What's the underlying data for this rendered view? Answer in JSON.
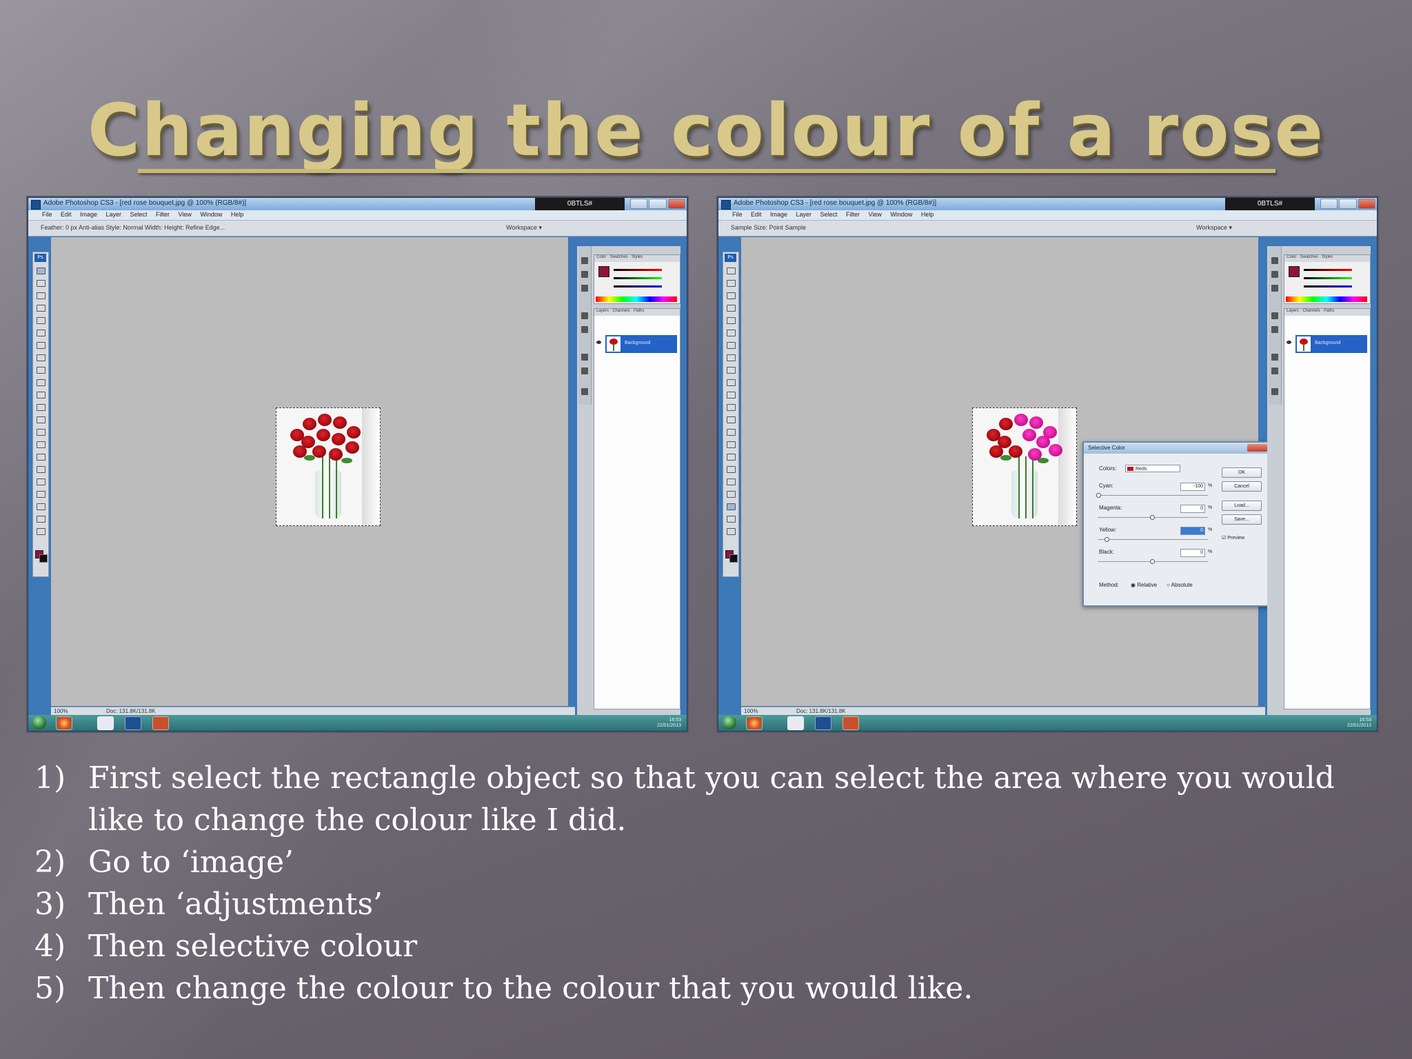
{
  "slide": {
    "title": "Changing the colour of a rose"
  },
  "screenshots": {
    "left": {
      "window_title": "Adobe Photoshop CS3 - [red rose bouquet.jpg @ 100% (RGB/8#)]",
      "user": "0BTLS#",
      "menus": "File Edit Image Layer Select Filter View Window Help",
      "options": "Feather: 0 px     Anti-alias     Style: Normal     Width:     Height:     Refine Edge...",
      "workspace": "Workspace ▾",
      "layer_name": "Background",
      "zoom": "100%",
      "doc_info": "Doc: 131.8K/131.8K"
    },
    "right": {
      "window_title": "Adobe Photoshop CS3 - [red rose bouquet.jpg @ 100% (RGB/8#)]",
      "user": "0BTLS#",
      "menus": "File Edit Image Layer Select Filter View Window Help",
      "options": "Sample Size: Point Sample",
      "workspace": "Workspace ▾",
      "layer_name": "Background",
      "zoom": "100%",
      "doc_info": "Doc: 131.8K/131.8K",
      "dialog": {
        "title": "Selective Color",
        "colors_label": "Colors:",
        "colors_value": "Reds",
        "cyan_label": "Cyan:",
        "cyan_value": "-100",
        "magenta_label": "Magenta:",
        "magenta_value": "0",
        "yellow_label": "Yellow:",
        "yellow_value": "0",
        "black_label": "Black:",
        "black_value": "0",
        "percent": "%",
        "ok": "OK",
        "cancel": "Cancel",
        "load": "Load...",
        "save": "Save...",
        "preview": "Preview",
        "method_label": "Method:",
        "relative": "Relative",
        "absolute": "Absolute"
      }
    },
    "taskbar_time": "16:53",
    "taskbar_date": "22/01/2013"
  },
  "steps": [
    {
      "num": "1)",
      "text": "First select the rectangle object so that you can select the area where you would like to change the colour like I did."
    },
    {
      "num": "2)",
      "text": "Go to ‘image’"
    },
    {
      "num": "3)",
      "text": "Then ‘adjustments’"
    },
    {
      "num": "4)",
      "text": "Then selective colour"
    },
    {
      "num": "5)",
      "text": "Then change the colour to the colour that you would like."
    }
  ],
  "colors": {
    "title_gold": "#d8c98a",
    "rose_red": "#c0121a",
    "rose_pink": "#d1169a",
    "layer_highlight": "#2462c6"
  }
}
